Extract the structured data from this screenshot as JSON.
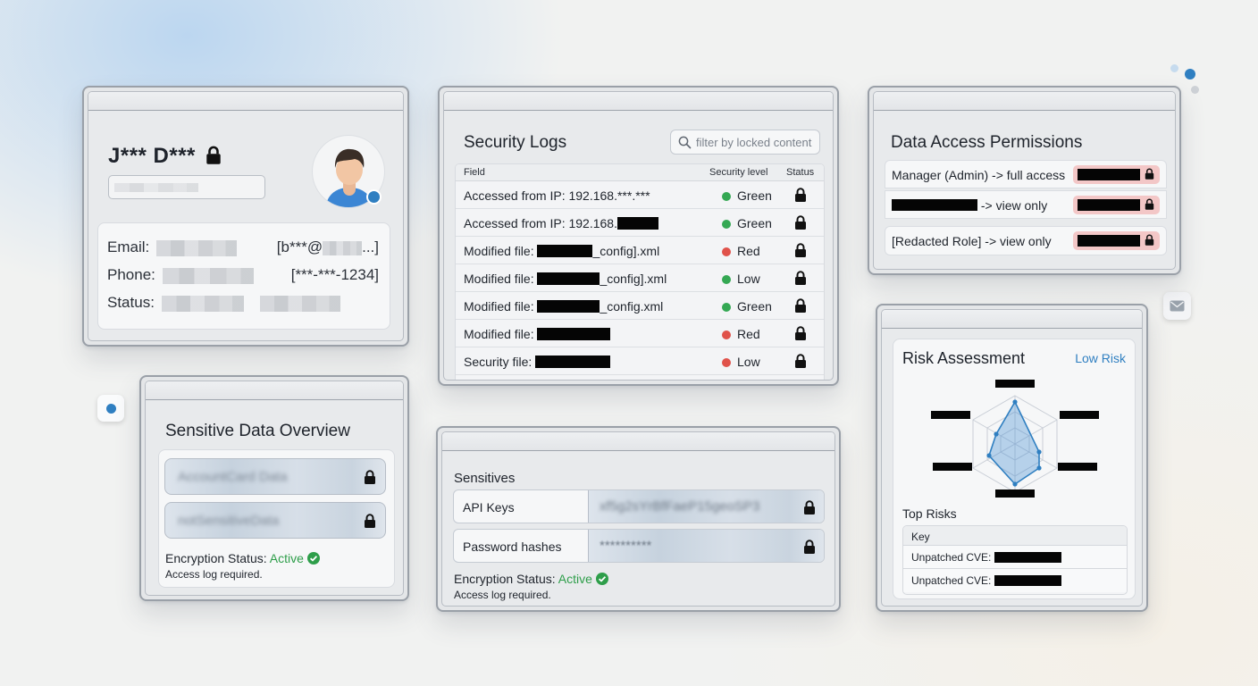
{
  "profile": {
    "name": "J*** D***",
    "email_label": "Email:",
    "email_value": "[b***@",
    "email_suffix": "...]",
    "phone_label": "Phone:",
    "phone_value": "[***-***-1234]",
    "status_label": "Status:"
  },
  "security_logs": {
    "title": "Security Logs",
    "search_placeholder": "filter by locked content",
    "columns": [
      "Field",
      "Security level",
      "Status"
    ],
    "rows": [
      {
        "prefix": "Accessed from IP: 192.168.***.***",
        "suffix": "",
        "redact": 0,
        "level": "Green",
        "color": "#34a853"
      },
      {
        "prefix": "Accessed from IP: 192.168.",
        "suffix": "",
        "redact": 46,
        "level": "Green",
        "color": "#34a853"
      },
      {
        "prefix": "Modified file: ",
        "suffix": "_config].xml",
        "redact": 62,
        "level": "Red",
        "color": "#e0524a"
      },
      {
        "prefix": "Modified file: ",
        "suffix": "_config].xml",
        "redact": 70,
        "level": "Low",
        "color": "#34a853"
      },
      {
        "prefix": "Modified file: ",
        "suffix": "_config.xml",
        "redact": 70,
        "level": "Green",
        "color": "#34a853"
      },
      {
        "prefix": "Modified file: ",
        "suffix": "",
        "redact": 82,
        "level": "Red",
        "color": "#e0524a"
      },
      {
        "prefix": "Security file: ",
        "suffix": "",
        "redact": 84,
        "level": "Low",
        "color": "#e0524a"
      }
    ]
  },
  "permissions": {
    "title": "Data Access Permissions",
    "rows": [
      {
        "prefix": "Manager (Admin) -> full access",
        "redact_prefix": 0
      },
      {
        "prefix": " -> view only",
        "redact_prefix": 96
      },
      {
        "prefix": "[Redacted Role] -> view only",
        "redact_prefix": 0
      }
    ]
  },
  "sensitive_overview": {
    "title": "Sensitive Data Overview",
    "blur1": "AccountCard Data",
    "blur2": "notSensitiveData",
    "enc_label": "Encryption Status:",
    "enc_value": "Active",
    "note": "Access log required."
  },
  "sensitives": {
    "title": "Sensitives",
    "rows": [
      {
        "label": "API Keys",
        "value": "xf5g2sYrBfFaeP15geoSP3"
      },
      {
        "label": "Password hashes",
        "value": "**********"
      }
    ],
    "enc_label": "Encryption Status:",
    "enc_value": "Active",
    "note": "Access log required."
  },
  "risk": {
    "title": "Risk Assessment",
    "badge": "Low Risk",
    "top_risks_title": "Top Risks",
    "table_header": "Key",
    "rows": [
      "Unpatched CVE:",
      "Unpatched CVE:"
    ]
  },
  "colors": {
    "accent": "#2f7fc1",
    "success": "#2e9e4a",
    "danger": "#e0524a",
    "redact": "#050505",
    "redact_badge": "#f3c7c7"
  },
  "icons": {
    "lock": "lock-icon",
    "search": "search-icon",
    "avatar": "avatar",
    "mail": "mail-icon",
    "check": "check-circle-icon"
  }
}
